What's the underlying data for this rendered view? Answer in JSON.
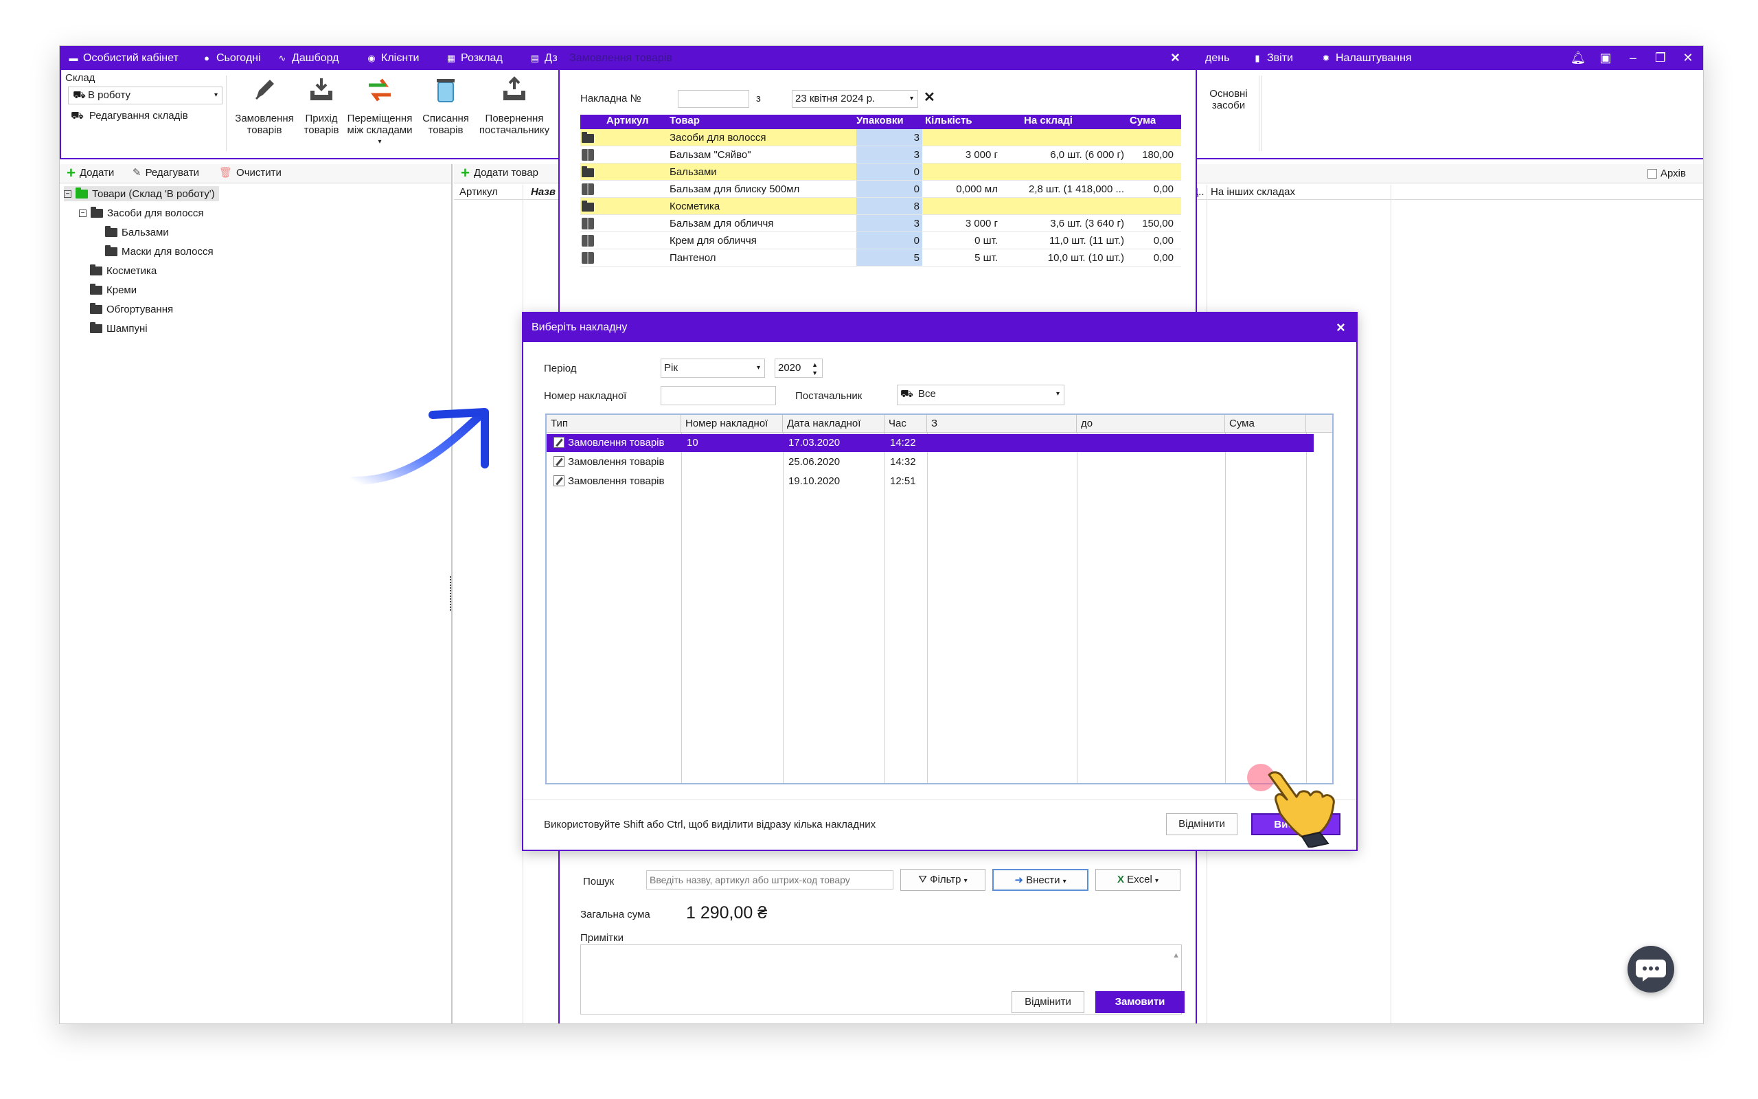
{
  "topbar": {
    "items": [
      {
        "label": "Особистий кабінет",
        "icon": "wallet-icon"
      },
      {
        "label": "Сьогодні",
        "icon": "circle-icon"
      },
      {
        "label": "Дашборд",
        "icon": "pulse-icon"
      },
      {
        "label": "Клієнти",
        "icon": "user-icon"
      },
      {
        "label": "Розклад",
        "icon": "calendar-icon"
      },
      {
        "label": "Дз",
        "icon": "archive-icon"
      },
      {
        "label": "день",
        "icon": ""
      },
      {
        "label": "Звіти",
        "icon": "bar-chart-icon"
      },
      {
        "label": "Налаштування",
        "icon": "gear-icon"
      }
    ],
    "colors": {
      "accent": "#5b10d1"
    }
  },
  "ribbon": {
    "warehouse_label": "Склад",
    "warehouse_value": "В роботу",
    "edit_warehouses": "Редагування складів",
    "buttons": [
      {
        "line1": "Замовлення",
        "line2": "товарів"
      },
      {
        "line1": "Прихід",
        "line2": "товарів"
      },
      {
        "line1": "Переміщення",
        "line2": "між складами"
      },
      {
        "line1": "Списання",
        "line2": "товарів"
      },
      {
        "line1": "Повернення",
        "line2": "постачальнику"
      }
    ],
    "assets_line1": "Основні",
    "assets_line2": "засоби"
  },
  "left": {
    "toolbar": {
      "add": "Додати",
      "edit": "Редагувати",
      "clear": "Очистити"
    },
    "tree": {
      "root": "Товари (Склад 'В роботу')",
      "hair": "Засоби для волосся",
      "balms": "Бальзами",
      "masks": "Маски для волосся",
      "cosmetics": "Косметика",
      "creams": "Креми",
      "wraps": "Обгортування",
      "shampoos": "Шампуні"
    }
  },
  "right": {
    "add_product": "Додати товар",
    "col_article": "Артикул",
    "col_name": "Назв",
    "col_d": "Д..",
    "col_other": "На інших складах",
    "archive": "Архів"
  },
  "order": {
    "title": "Замовлення товарів",
    "invoice_label": "Накладна №",
    "from_label": "з",
    "date_value": "23 квітня 2024 р.",
    "headers": {
      "article": "Артикул",
      "product": "Товар",
      "packages": "Упаковки",
      "quantity": "Кількість",
      "stock": "На складі",
      "sum": "Сума"
    },
    "rows": [
      {
        "group": true,
        "product": "Засоби для волосся",
        "packages": "3",
        "quantity": "",
        "stock": "",
        "sum": ""
      },
      {
        "group": false,
        "product": "Бальзам \"Сяйво\"",
        "packages": "3",
        "quantity": "3 000 г",
        "stock": "6,0 шт. (6 000 г)",
        "sum": "180,00"
      },
      {
        "group": true,
        "product": "Бальзами",
        "packages": "0",
        "quantity": "",
        "stock": "",
        "sum": ""
      },
      {
        "group": false,
        "product": "Бальзам для блиску 500мл",
        "packages": "0",
        "quantity": "0,000 мл",
        "stock": "2,8 шт. (1 418,000 ...",
        "sum": "0,00"
      },
      {
        "group": true,
        "product": "Косметика",
        "packages": "8",
        "quantity": "",
        "stock": "",
        "sum": ""
      },
      {
        "group": false,
        "product": "Бальзам для обличчя",
        "packages": "3",
        "quantity": "3 000 г",
        "stock": "3,6 шт. (3 640 г)",
        "sum": "150,00"
      },
      {
        "group": false,
        "product": "Крем для обличчя",
        "packages": "0",
        "quantity": "0 шт.",
        "stock": "11,0 шт. (11 шт.)",
        "sum": "0,00"
      },
      {
        "group": false,
        "product": "Пантенол",
        "packages": "5",
        "quantity": "5 шт.",
        "stock": "10,0 шт. (10 шт.)",
        "sum": "0,00"
      }
    ],
    "search_label": "Пошук",
    "search_placeholder": "Введіть назву, артикул або штрих-код товару",
    "filter": "Фільтр",
    "insert": "Внести",
    "excel": "Excel",
    "total_label": "Загальна сума",
    "total_value": "1 290,00 ₴",
    "notes_label": "Примітки",
    "cancel": "Відмінити",
    "order_btn": "Замовити"
  },
  "dialog": {
    "title": "Виберіть накладну",
    "period_label": "Період",
    "period_value": "Рік",
    "year_value": "2020",
    "number_label": "Номер накладної",
    "supplier_label": "Постачальник",
    "supplier_value": "Все",
    "columns": {
      "type": "Тип",
      "number": "Номер накладної",
      "date": "Дата накладної",
      "time": "Час",
      "from": "З",
      "to": "до",
      "sum": "Сума"
    },
    "rows": [
      {
        "type": "Замовлення товарів",
        "number": "10",
        "date": "17.03.2020",
        "time": "14:22",
        "selected": true
      },
      {
        "type": "Замовлення товарів",
        "number": "",
        "date": "25.06.2020",
        "time": "14:32",
        "selected": false
      },
      {
        "type": "Замовлення товарів",
        "number": "",
        "date": "19.10.2020",
        "time": "12:51",
        "selected": false
      }
    ],
    "hint": "Використовуйте Shift або Ctrl, щоб виділити відразу кілька накладних",
    "cancel": "Відмінити",
    "select": "Вибрати"
  }
}
